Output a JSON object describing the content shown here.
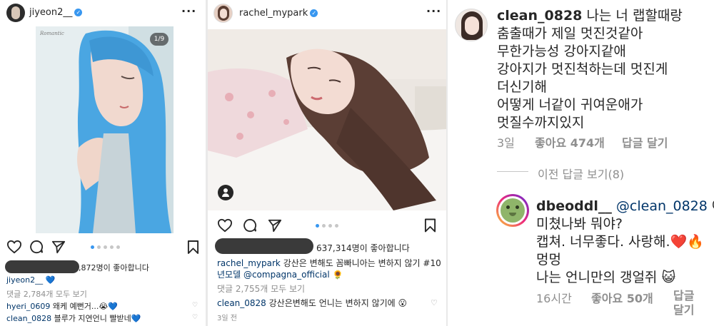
{
  "post1": {
    "username": "jiyeon2__",
    "photo_counter": "1/9",
    "photo_watermark": "Romantic",
    "likes_suffix": ",872명이 좋아합니다",
    "caption_user": "jiyeon2__",
    "caption_emoji": "💙",
    "view_comments": "댓글 2,784개 모두 보기",
    "comments": [
      {
        "user": "hyeri_0609",
        "text": "왜케 예뻔거...😭💙"
      },
      {
        "user": "clean_0828",
        "text": "블루가 지연언니 빨받네💙"
      }
    ]
  },
  "post2": {
    "username": "rachel_mypark",
    "likes": "637,314명이 좋아합니다",
    "caption_user": "rachel_mypark",
    "caption_line1": "강산은 변해도 꼼빠니아는 변하지 않기 #10",
    "caption_line2_tag": "년모델",
    "caption_line2_mention": "@compagna_official",
    "caption_line2_emoji": "🌻",
    "view_comments": "댓글 2,755개 모두 보기",
    "comment_user": "clean_0828",
    "comment_text": "강산은변해도 언니는 변하지 않기에 😮",
    "time": "3일 전"
  },
  "comment_detail": {
    "main_user": "clean_0828",
    "main_lines": [
      "나는 너 랩할때랑",
      "춤출때가 제일 멋진것같아",
      "무한가능성 강아지같애",
      "강아지가 멋진척하는데 멋진게",
      "더신기해",
      "어떻게 너같이 귀여운애가",
      "멋질수까지있지"
    ],
    "main_time": "3일",
    "main_likes": "좋아요 474개",
    "main_reply": "답글 달기",
    "view_previous": "이전 답글 보기(8)",
    "reply_user": "dbeoddl__",
    "reply_mention": "@clean_0828",
    "reply_line1_tail": "아",
    "reply_line2": "미쳤나봐 뭐야?",
    "reply_line3": "캡쳐. 너무좋다. 사랑해.❤️🔥",
    "reply_line4": "멍멍",
    "reply_line5": "나는 언니만의 갱얼쥐 😺",
    "reply_time": "16시간",
    "reply_likes": "좋아요 50개",
    "reply_reply_1": "답글",
    "reply_reply_2": "달기"
  },
  "icons": [
    "heart-icon",
    "comment-icon",
    "share-icon",
    "bookmark-icon",
    "verified-icon",
    "more-icon",
    "user-tag-icon"
  ],
  "colors": {
    "verified": "#3897f0",
    "muted": "#8e8e8e",
    "hair": "#4aa6e2",
    "divider": "#e9e9e9"
  }
}
